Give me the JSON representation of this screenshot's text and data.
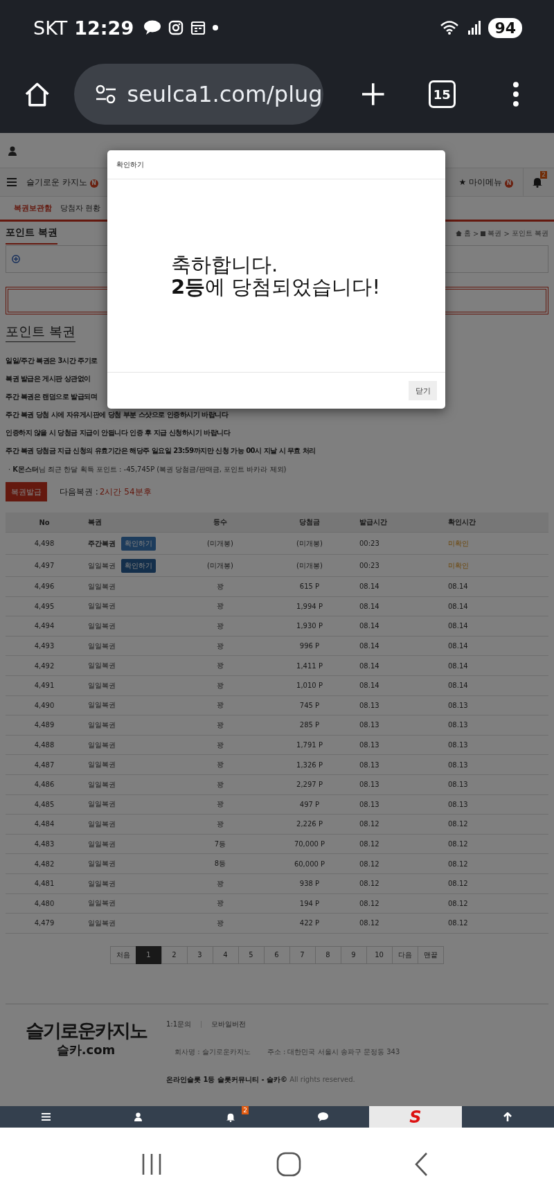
{
  "status_bar": {
    "carrier": "SKT",
    "time": "12:29",
    "battery": "94"
  },
  "browser": {
    "url": "seulca1.com/plug",
    "tab_count": "15"
  },
  "nav": {
    "items": [
      {
        "label": "슬기로운 카지노",
        "badge": "N"
      },
      {
        "label": "★ 마이메뉴",
        "badge": "N"
      }
    ],
    "notification_count": "2"
  },
  "sub_tabs": [
    {
      "label": "복권보관함",
      "selected": true
    },
    {
      "label": "당첨자 현황",
      "selected": false
    }
  ],
  "section": {
    "title": "포인트 복권",
    "breadcrumb": [
      "홈",
      "복권",
      "포인트 복권"
    ],
    "separator": ">"
  },
  "heading": "포인트 복권",
  "notes": [
    "일일/주간 복권은 3시간 주기로",
    "복권 발급은 게시판 상관없이",
    "주간 복권은 랜덤으로 발급되며",
    "주간 복권 당첨 시에 자유게시판에 당첨 부분 스샷으로 인증하시기 바랍니다",
    "인증하지 않을 시 당첨금 지급이 안됩니다 인증 후 지급 신청하시기 바랍니다",
    "주간 복권 당첨금 지급 신청의 유효기간은 해당주 일요일 23:59까지만 신청 가능 00시 지날 시 무효 처리"
  ],
  "points_line": "· **K몬스터**님 최근 한달 획득 포인트 : -45,745P (복권 당첨금/판매금, 포인트 바카라 제외)",
  "issue_button": "복권발급",
  "next_ticket": {
    "label": "다음복권 :",
    "value": "2시간 54분후"
  },
  "table": {
    "columns": [
      "No",
      "복권",
      "등수",
      "당첨금",
      "발급시간",
      "확인시간"
    ],
    "rows": [
      {
        "no": "4,498",
        "ticket": "주간복권",
        "emphasized": true,
        "action": "확인하기",
        "rank": "(미개봉)",
        "prize": "(미개봉)",
        "issued": "00:23",
        "checked_time": "미확인",
        "confirmed": false
      },
      {
        "no": "4,497",
        "ticket": "일일복권",
        "emphasized": false,
        "action": "확인하기",
        "rank": "(미개봉)",
        "prize": "(미개봉)",
        "issued": "00:23",
        "checked_time": "미확인",
        "confirmed": false
      },
      {
        "no": "4,496",
        "ticket": "일일복권",
        "emphasized": false,
        "rank": "꽝",
        "prize": "615 P",
        "issued": "08.14",
        "checked_time": "08.14",
        "confirmed": true
      },
      {
        "no": "4,495",
        "ticket": "일일복권",
        "emphasized": false,
        "rank": "꽝",
        "prize": "1,994 P",
        "issued": "08.14",
        "checked_time": "08.14",
        "confirmed": true
      },
      {
        "no": "4,494",
        "ticket": "일일복권",
        "emphasized": false,
        "rank": "꽝",
        "prize": "1,930 P",
        "issued": "08.14",
        "checked_time": "08.14",
        "confirmed": true
      },
      {
        "no": "4,493",
        "ticket": "일일복권",
        "emphasized": false,
        "rank": "꽝",
        "prize": "996 P",
        "issued": "08.14",
        "checked_time": "08.14",
        "confirmed": true
      },
      {
        "no": "4,492",
        "ticket": "일일복권",
        "emphasized": false,
        "rank": "꽝",
        "prize": "1,411 P",
        "issued": "08.14",
        "checked_time": "08.14",
        "confirmed": true
      },
      {
        "no": "4,491",
        "ticket": "일일복권",
        "emphasized": false,
        "rank": "꽝",
        "prize": "1,010 P",
        "issued": "08.14",
        "checked_time": "08.14",
        "confirmed": true
      },
      {
        "no": "4,490",
        "ticket": "일일복권",
        "emphasized": false,
        "rank": "꽝",
        "prize": "745 P",
        "issued": "08.13",
        "checked_time": "08.13",
        "confirmed": true
      },
      {
        "no": "4,489",
        "ticket": "일일복권",
        "emphasized": false,
        "rank": "꽝",
        "prize": "285 P",
        "issued": "08.13",
        "checked_time": "08.13",
        "confirmed": true
      },
      {
        "no": "4,488",
        "ticket": "일일복권",
        "emphasized": false,
        "rank": "꽝",
        "prize": "1,791 P",
        "issued": "08.13",
        "checked_time": "08.13",
        "confirmed": true
      },
      {
        "no": "4,487",
        "ticket": "일일복권",
        "emphasized": false,
        "rank": "꽝",
        "prize": "1,326 P",
        "issued": "08.13",
        "checked_time": "08.13",
        "confirmed": true
      },
      {
        "no": "4,486",
        "ticket": "일일복권",
        "emphasized": false,
        "rank": "꽝",
        "prize": "2,297 P",
        "issued": "08.13",
        "checked_time": "08.13",
        "confirmed": true
      },
      {
        "no": "4,485",
        "ticket": "일일복권",
        "emphasized": false,
        "rank": "꽝",
        "prize": "497 P",
        "issued": "08.13",
        "checked_time": "08.13",
        "confirmed": true
      },
      {
        "no": "4,484",
        "ticket": "일일복권",
        "emphasized": false,
        "rank": "꽝",
        "prize": "2,226 P",
        "issued": "08.12",
        "checked_time": "08.12",
        "confirmed": true
      },
      {
        "no": "4,483",
        "ticket": "일일복권",
        "emphasized": false,
        "rank": "7등",
        "prize": "70,000 P",
        "issued": "08.12",
        "checked_time": "08.12",
        "confirmed": true
      },
      {
        "no": "4,482",
        "ticket": "일일복권",
        "emphasized": false,
        "rank": "8등",
        "prize": "60,000 P",
        "issued": "08.12",
        "checked_time": "08.12",
        "confirmed": true
      },
      {
        "no": "4,481",
        "ticket": "일일복권",
        "emphasized": false,
        "rank": "꽝",
        "prize": "938 P",
        "issued": "08.12",
        "checked_time": "08.12",
        "confirmed": true
      },
      {
        "no": "4,480",
        "ticket": "일일복권",
        "emphasized": false,
        "rank": "꽝",
        "prize": "194 P",
        "issued": "08.12",
        "checked_time": "08.12",
        "confirmed": true
      },
      {
        "no": "4,479",
        "ticket": "일일복권",
        "emphasized": false,
        "rank": "꽝",
        "prize": "422 P",
        "issued": "08.12",
        "checked_time": "08.12",
        "confirmed": true
      }
    ]
  },
  "pagination": [
    {
      "label": "처음",
      "selected": false
    },
    {
      "label": "1",
      "selected": true
    },
    {
      "label": "2",
      "selected": false
    },
    {
      "label": "3",
      "selected": false
    },
    {
      "label": "4",
      "selected": false
    },
    {
      "label": "5",
      "selected": false
    },
    {
      "label": "6",
      "selected": false
    },
    {
      "label": "7",
      "selected": false
    },
    {
      "label": "8",
      "selected": false
    },
    {
      "label": "9",
      "selected": false
    },
    {
      "label": "10",
      "selected": false
    },
    {
      "label": "다음",
      "selected": false
    },
    {
      "label": "맨끝",
      "selected": false
    }
  ],
  "footer": {
    "logo": "슬기로운카지노",
    "logo_sub": "슬카.com",
    "links": [
      "1:1문의",
      "모바일버전"
    ],
    "company": "회사명 : 슬기로운카지노",
    "address": "주소 : 대한민국 서울시 송파구 문정동 343",
    "copyright": "**온라인슬롯 1등 슬롯커뮤니티 - 슬카©** All rights reserved."
  },
  "bottom_nav": [
    {
      "kind": "menu",
      "selected": false
    },
    {
      "kind": "user",
      "selected": false
    },
    {
      "kind": "bell",
      "badge": "2",
      "selected": false
    },
    {
      "kind": "chat",
      "selected": false
    },
    {
      "kind": "logo",
      "label": "S",
      "selected": true
    },
    {
      "kind": "top",
      "selected": false
    }
  ],
  "modal": {
    "title": "확인하기",
    "lines": [
      "축하합니다.",
      "**2등**에 당첨되었습니다!"
    ],
    "close_button": "닫기"
  }
}
